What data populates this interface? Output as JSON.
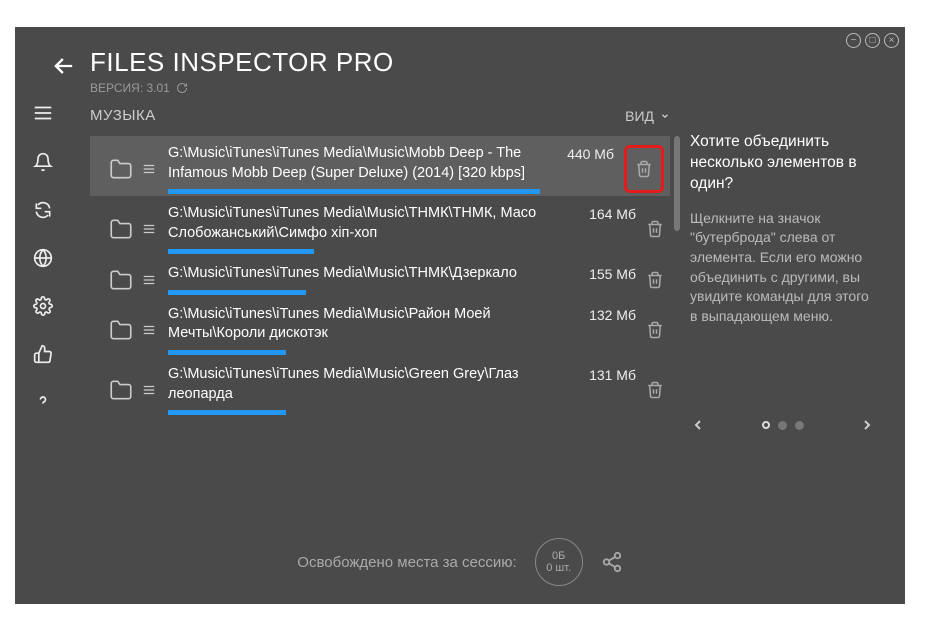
{
  "header": {
    "title": "FILES INSPECTOR PRO",
    "version_label": "ВЕРСИЯ: 3.01"
  },
  "section": {
    "title": "МУЗЫКА",
    "view_label": "ВИД"
  },
  "items": [
    {
      "path": "G:\\Music\\iTunes\\iTunes Media\\Music\\Mobb Deep - The Infamous Mobb Deep (Super Deluxe) (2014) [320 kbps]",
      "size": "440 Мб",
      "bar_pct": 100,
      "selected": true,
      "highlight_delete": true
    },
    {
      "path": "G:\\Music\\iTunes\\iTunes Media\\Music\\ТНМК\\ТНМК, Масо Слобожанський\\Симфо хіп-хоп",
      "size": "164 Мб",
      "bar_pct": 37,
      "selected": false,
      "highlight_delete": false
    },
    {
      "path": "G:\\Music\\iTunes\\iTunes Media\\Music\\ТНМК\\Дзеркало",
      "size": "155 Мб",
      "bar_pct": 35,
      "selected": false,
      "highlight_delete": false
    },
    {
      "path": "G:\\Music\\iTunes\\iTunes Media\\Music\\Район Моей Мечты\\Короли дискотэк",
      "size": "132 Мб",
      "bar_pct": 30,
      "selected": false,
      "highlight_delete": false
    },
    {
      "path": "G:\\Music\\iTunes\\iTunes Media\\Music\\Green Grey\\Глаз леопарда",
      "size": "131 Мб",
      "bar_pct": 30,
      "selected": false,
      "highlight_delete": false
    }
  ],
  "info": {
    "title": "Хотите объединить несколько элементов в один?",
    "body": "Щелкните на значок \"бутерброда\" слева от элемента. Если его можно объединить с другими, вы увидите команды для этого в выпадающем меню."
  },
  "footer": {
    "session_label": "Освобождено места за сессию:",
    "bytes": "0Б",
    "count": "0 шт."
  },
  "sidebar_icons": [
    "menu",
    "bell",
    "refresh",
    "globe",
    "gear",
    "thumbs-up",
    "help"
  ]
}
